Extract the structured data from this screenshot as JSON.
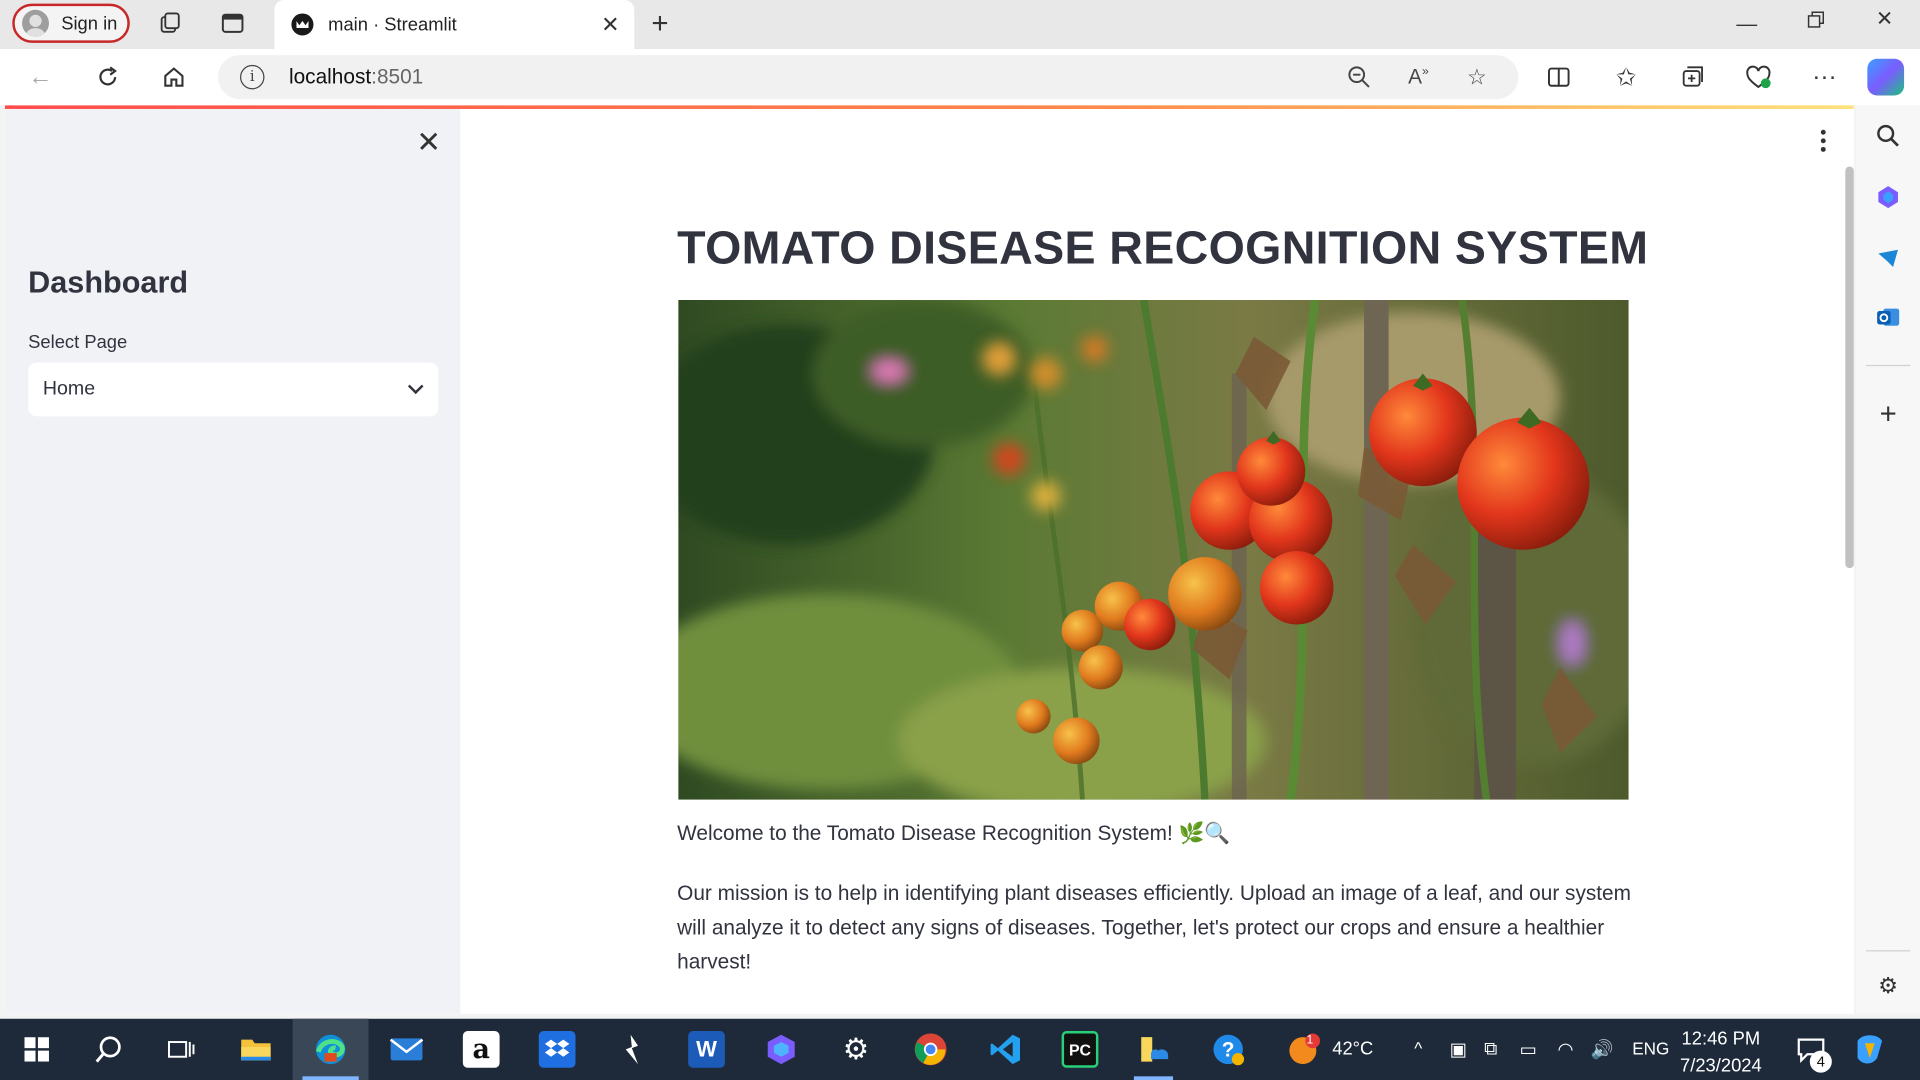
{
  "browser": {
    "sign_in_label": "Sign in",
    "tab_title": "main · Streamlit",
    "tab_close": "✕",
    "new_tab": "+",
    "url_host": "localhost",
    "url_port": ":8501"
  },
  "sidebar": {
    "close": "✕",
    "heading": "Dashboard",
    "select_label": "Select Page",
    "select_value": "Home"
  },
  "main": {
    "title": "TOMATO DISEASE RECOGNITION SYSTEM",
    "welcome": "Welcome to the Tomato Disease Recognition System! 🌿🔍",
    "mission": "Our mission is to help in identifying plant diseases efficiently. Upload an image of a leaf, and our system will analyze it to detect any signs of diseases. Together, let's protect our crops and ensure a healthier harvest!"
  },
  "taskbar": {
    "temperature": "42°C",
    "language": "ENG",
    "time": "12:46 PM",
    "date": "7/23/2024",
    "weather_badge": "1",
    "notification_count": "4"
  },
  "colors": {
    "accent": "#ff4b4b",
    "sidebar_bg": "#f0f2f6",
    "text": "#31333f"
  }
}
